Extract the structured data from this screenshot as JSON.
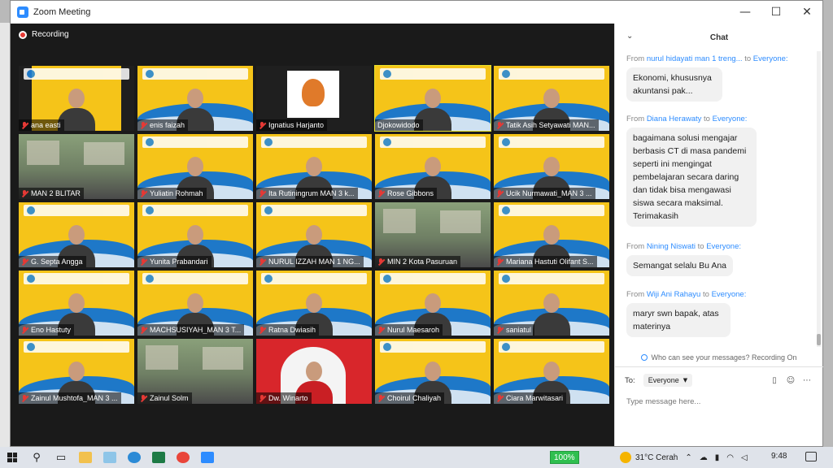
{
  "window": {
    "title": "Zoom Meeting",
    "minimize": "—",
    "maximize": "☐",
    "close": "✕"
  },
  "meeting": {
    "recording_label": "Recording"
  },
  "participants": [
    {
      "name": "ana easti",
      "kind": "person-dark"
    },
    {
      "name": "enis faizah",
      "kind": "banner"
    },
    {
      "name": "Ignatius Harjanto",
      "kind": "logo"
    },
    {
      "name": "Djokowidodo",
      "kind": "banner",
      "active": true,
      "muted": false
    },
    {
      "name": "Tatik Asih Setyawati MAN...",
      "kind": "banner"
    },
    {
      "name": "MAN 2 BLITAR",
      "kind": "photo"
    },
    {
      "name": "Yuliatin Rohmah",
      "kind": "banner"
    },
    {
      "name": "Ita Rutiningrum MAN 3 k...",
      "kind": "banner"
    },
    {
      "name": "Rose Gibbons",
      "kind": "banner"
    },
    {
      "name": "Ucik Nurmawati_MAN 3 ...",
      "kind": "banner"
    },
    {
      "name": "G. Septa Angga",
      "kind": "banner"
    },
    {
      "name": "Yunita Prabandari",
      "kind": "banner"
    },
    {
      "name": "NURUL IZZAH MAN 1 NG...",
      "kind": "banner"
    },
    {
      "name": "MIN 2 Kota Pasuruan",
      "kind": "photo"
    },
    {
      "name": "Mariana Hastuti Olifant S...",
      "kind": "banner"
    },
    {
      "name": "Eno Hastuty",
      "kind": "banner"
    },
    {
      "name": "MACHSUSIYAH_MAN 3 T...",
      "kind": "banner"
    },
    {
      "name": "Ratna Dwiasih",
      "kind": "banner"
    },
    {
      "name": "Nurul Maesaroh",
      "kind": "banner"
    },
    {
      "name": "saniatul",
      "kind": "banner"
    },
    {
      "name": "Zainul Mushtofa_MAN 3 ...",
      "kind": "banner"
    },
    {
      "name": "Zainul Solm",
      "kind": "photo"
    },
    {
      "name": "Dw. Winarto",
      "kind": "red"
    },
    {
      "name": "Choirul Chaliyah",
      "kind": "banner"
    },
    {
      "name": "Ciara Marwitasari",
      "kind": "banner"
    }
  ],
  "chat": {
    "title": "Chat",
    "collapse_icon": "⌄",
    "from_label": "From",
    "to_label": "to",
    "messages": [
      {
        "sender": "nurul hidayati man 1 treng...",
        "recipient": "Everyone:",
        "text": "Ekonomi, khususnya akuntansi pak..."
      },
      {
        "sender": "Diana Herawaty",
        "recipient": "Everyone:",
        "text": "bagaimana solusi mengajar berbasis CT di masa pandemi seperti ini mengingat pembelajaran secara daring dan tidak bisa mengawasi siswa secara maksimal. Terimakasih"
      },
      {
        "sender": "Nining Niswati",
        "recipient": "Everyone:",
        "text": "Semangat selalu Bu Ana"
      },
      {
        "sender": "Wiji Ani Rahayu",
        "recipient": "Everyone:",
        "text": "maryr swn bapak, atas materinya"
      }
    ],
    "privacy_note": "Who can see your messages? Recording On",
    "to_field_label": "To:",
    "to_value": "Everyone",
    "input_placeholder": "Type message here..."
  },
  "taskbar": {
    "zoom_level": "100%",
    "weather": "31°C  Cerah",
    "time": "9:48"
  },
  "colors": {
    "accent": "#2d8cff",
    "banner_yellow": "#f5c419",
    "banner_blue": "#1e78c8",
    "muted_red": "#e53935"
  }
}
